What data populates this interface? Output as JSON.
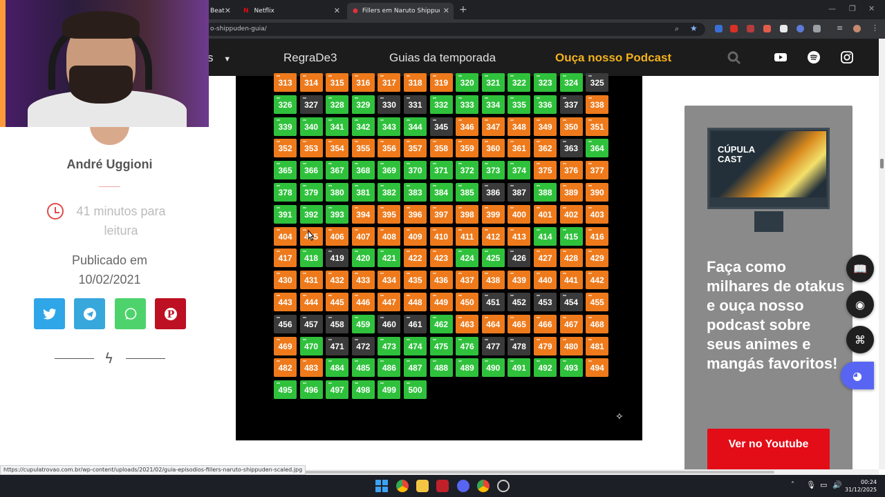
{
  "browser": {
    "tabs": [
      {
        "label": "Beat"
      },
      {
        "label": "Netflix"
      },
      {
        "label": "Fillers em Naruto Shippuden: se"
      }
    ],
    "url": "o-shippuden-guia/",
    "new_tab": "+"
  },
  "site_nav": {
    "partial_item": "s",
    "links": [
      {
        "label": "RegraDe3"
      },
      {
        "label": "Guias da temporada"
      },
      {
        "label": "Ouça nosso Podcast"
      }
    ]
  },
  "sidebar": {
    "author": "André Uggioni",
    "read_time": "41 minutos para leitura",
    "published_label": "Publicado em",
    "published_date": "10/02/2021"
  },
  "episodes": {
    "legend_colors": {
      "o": "#ee7a1c",
      "g": "#2fc13c",
      "d": "#3a3a3a"
    },
    "rows": [
      {
        "start": 313,
        "colors": "ooooooogggggdg"
      },
      {
        "start": 326,
        "colors": "gdggddgggggd"
      },
      {
        "start": 339,
        "colors": "ggggggdooooo"
      },
      {
        "start": 352,
        "colors": "ooooooooooodgg"
      },
      {
        "start": 365,
        "colors": "ggggggggggoo"
      },
      {
        "start": 378,
        "colors": "ggggggggddgooo"
      },
      {
        "start": 391,
        "colors": "gggooooooooooo"
      },
      {
        "start": 404,
        "colors": "ooooooooooggo"
      },
      {
        "start": 417,
        "colors": "ogdggooggdooo"
      },
      {
        "start": 430,
        "colors": "ooooooooooooo"
      },
      {
        "start": 443,
        "colors": "oooooooodddd"
      },
      {
        "start": 456,
        "colors": "dddgddgooooo"
      },
      {
        "start": 469,
        "colors": "ogddggggddoo"
      },
      {
        "start": 482,
        "colors": "oogggggggggg"
      },
      {
        "start": 495,
        "colors": "gggggg"
      }
    ],
    "last": 500
  },
  "promo": {
    "cover_title": "CÚPULA CAST",
    "headline": "Faça como milhares de otakus e ouça nosso podcast sobre seus animes e mangás favoritos!",
    "cta": "Ver no Youtube"
  },
  "status_bar": {
    "url": "https://cupulatrovao.com.br/wp-content/uploads/2021/02/guia-episodios-fillers-naruto-shippuden-scaled.jpg"
  },
  "taskbar": {
    "time": "00:24",
    "date": "31/12/2025"
  }
}
